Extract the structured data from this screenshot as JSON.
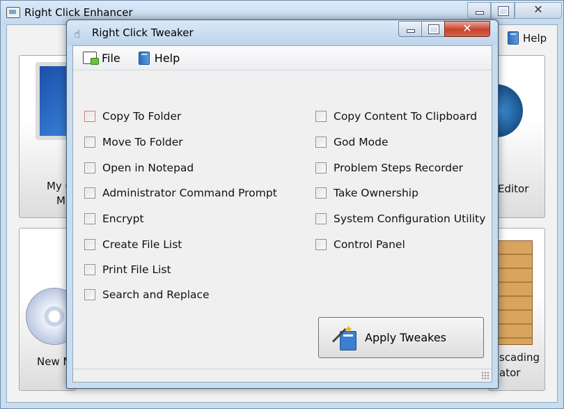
{
  "background_window": {
    "title": "Right Click Enhancer",
    "close_glyph": "✕",
    "help_menu": "Help",
    "tiles": [
      {
        "label_line1": "My C",
        "label_line2": "M"
      },
      {
        "label_line1": "Editor"
      },
      {
        "label_line1": "New M"
      },
      {
        "label_line1": "scading",
        "label_line2": "ator"
      }
    ]
  },
  "dialog": {
    "title": "Right Click Tweaker",
    "close_glyph": "✕",
    "menu": {
      "file": "File",
      "help": "Help"
    },
    "options_left": [
      {
        "label": "Copy To Folder",
        "checked": false
      },
      {
        "label": "Move To Folder",
        "checked": false
      },
      {
        "label": "Open in Notepad",
        "checked": false
      },
      {
        "label": "Administrator Command Prompt",
        "checked": false
      },
      {
        "label": "Encrypt",
        "checked": false
      },
      {
        "label": "Create File List",
        "checked": false
      },
      {
        "label": "Print File List",
        "checked": false
      },
      {
        "label": "Search and Replace",
        "checked": false
      }
    ],
    "options_right": [
      {
        "label": "Copy Content To Clipboard",
        "checked": false
      },
      {
        "label": "God Mode",
        "checked": false
      },
      {
        "label": "Problem Steps Recorder",
        "checked": false
      },
      {
        "label": "Take Ownership",
        "checked": false
      },
      {
        "label": "System Configuration Utility",
        "checked": false
      },
      {
        "label": "Control Panel",
        "checked": false
      }
    ],
    "apply_button": "Apply Tweakes"
  },
  "icons": {
    "app_icon": "window-icon",
    "dialog_icon": "hand-pointer-icon",
    "file_menu_icon": "file-go-icon",
    "help_menu_icon": "book-icon",
    "apply_icon": "magic-wand-icon"
  }
}
